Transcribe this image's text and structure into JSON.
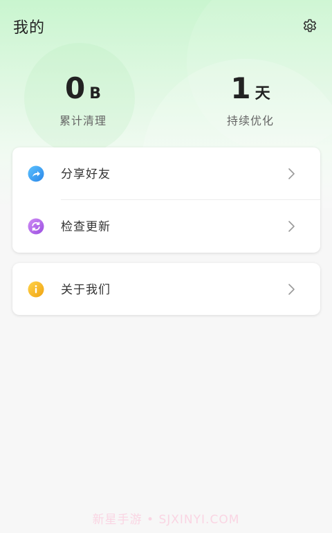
{
  "header": {
    "title": "我的",
    "settings_icon": "gear-icon"
  },
  "stats": {
    "cleaned": {
      "value": "0",
      "unit": "B",
      "label": "累计清理"
    },
    "optimized": {
      "value": "1",
      "unit": "天",
      "label": "持续优化"
    }
  },
  "menu": {
    "share": {
      "label": "分享好友",
      "icon": "share-icon",
      "icon_color": "#3aa0f0"
    },
    "update": {
      "label": "检查更新",
      "icon": "refresh-icon",
      "icon_color": "#b96be8"
    },
    "about": {
      "label": "关于我们",
      "icon": "info-icon",
      "icon_color": "#f2b21a"
    }
  },
  "watermark": "新星手游 • SJXINYI.COM",
  "colors": {
    "header_gradient_top": "#c9f5cf",
    "page_background": "#f7f7f7"
  }
}
